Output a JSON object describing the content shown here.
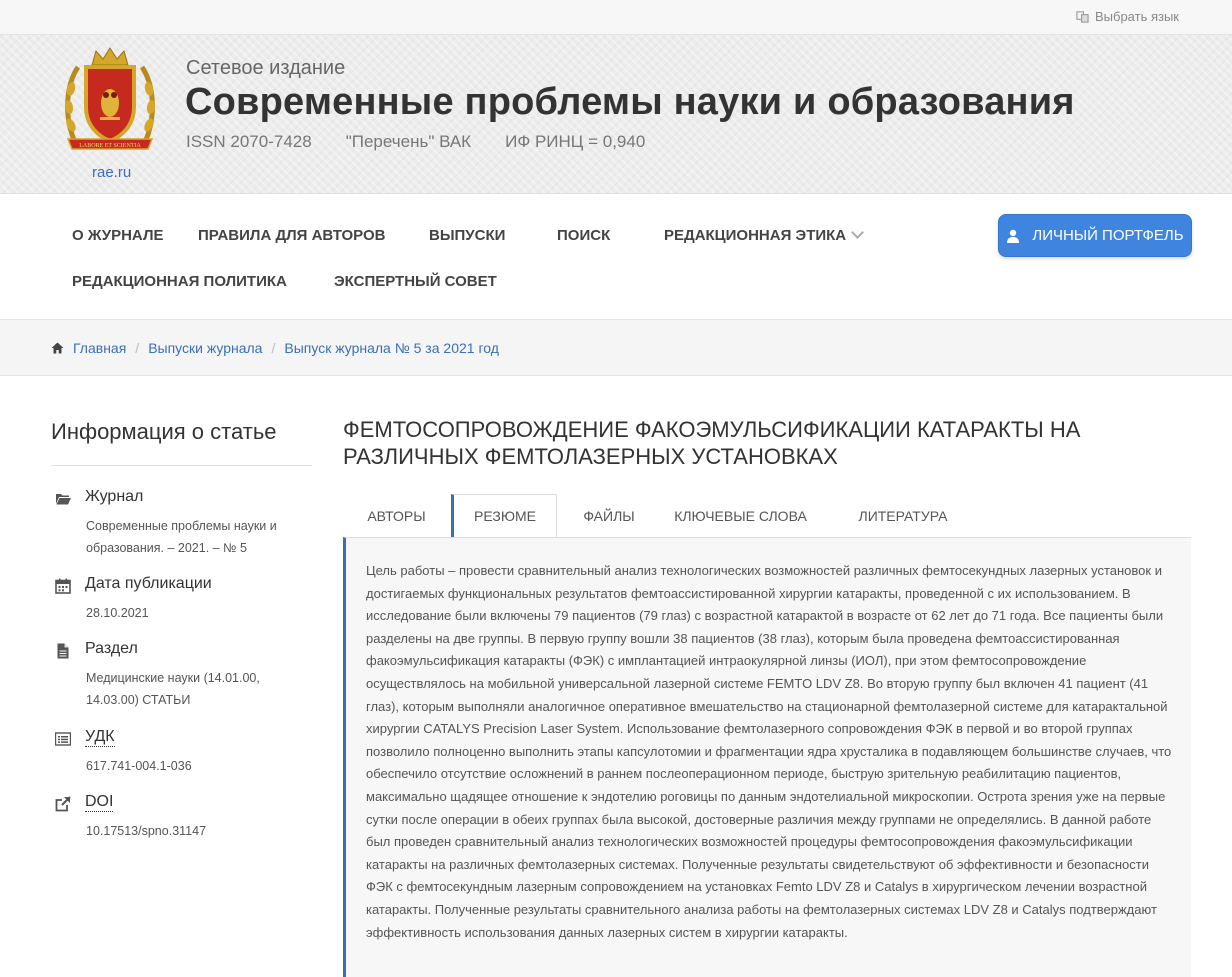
{
  "topbar": {
    "lang_label": "Выбрать язык"
  },
  "header": {
    "kicker": "Сетевое издание",
    "title": "Современные проблемы науки и образования",
    "issn": "ISSN 2070-7428",
    "vak": "\"Перечень\" ВАК",
    "rinc": "ИФ РИНЦ = 0,940",
    "site_link": "rae.ru",
    "logo_motto": "LABORE ET SCIENTIA"
  },
  "nav": {
    "items": [
      "О ЖУРНАЛЕ",
      "ПРАВИЛА ДЛЯ АВТОРОВ",
      "ВЫПУСКИ",
      "ПОИСК",
      "РЕДАКЦИОННАЯ ЭТИКА",
      "РЕДАКЦИОННАЯ ПОЛИТИКА",
      "ЭКСПЕРТНЫЙ СОВЕТ"
    ],
    "portfolio_label": "ЛИЧНЫЙ ПОРТФЕЛЬ"
  },
  "breadcrumb": [
    "Главная",
    "Выпуски журнала",
    "Выпуск журнала № 5 за 2021 год"
  ],
  "sidebar": {
    "title": "Информация о статье",
    "items": [
      {
        "icon": "folder-open-icon",
        "label": "Журнал",
        "value": "Современные проблемы науки и образования. – 2021. – № 5"
      },
      {
        "icon": "calendar-icon",
        "label": "Дата публикации",
        "value": "28.10.2021"
      },
      {
        "icon": "file-icon",
        "label": "Раздел",
        "value": "Медицинские науки (14.01.00, 14.03.00) СТАТЬИ"
      },
      {
        "icon": "list-icon",
        "label": "УДК",
        "value": "617.741-004.1-036"
      },
      {
        "icon": "external-link-icon",
        "label": "DOI",
        "value": "10.17513/spno.31147"
      }
    ]
  },
  "article": {
    "title": "ФЕМТОСОПРОВОЖДЕНИЕ ФАКОЭМУЛЬСИФИКАЦИИ КАТАРАКТЫ НА РАЗЛИЧНЫХ ФЕМТОЛАЗЕРНЫХ УСТАНОВКАХ",
    "tabs": [
      "АВТОРЫ",
      "РЕЗЮМЕ",
      "ФАЙЛЫ",
      "КЛЮЧЕВЫЕ СЛОВА",
      "ЛИТЕРАТУРА"
    ],
    "active_tab": "РЕЗЮМЕ",
    "abstract": "Цель работы – провести сравнительный анализ технологических возможностей различных фемтосекундных лазерных установок и достигаемых функциональных результатов фемтоассистированной хирургии катаракты, проведенной с их использованием. В исследование были включены 79 пациентов (79 глаз) с возрастной катарактой в возрасте от 62 лет до 71 года. Все пациенты были разделены на две группы. В первую группу вошли 38 пациентов (38 глаз), которым была проведена фемтоассистированная факоэмульсификация катаракты (ФЭК) с имплантацией интраокулярной линзы (ИОЛ), при этом фемтосопровождение осуществлялось на мобильной универсальной лазерной системе FEMTO LDV Z8. Во вторую группу был включен 41 пациент (41 глаз), которым выполняли аналогичное оперативное вмешательство на стационарной фемтолазерной системе для катарактальной хирургии CATALYS Precision Laser System. Использование фемтолазерного сопровождения ФЭК в первой и во второй группах позволило полноценно выполнить этапы капсулотомии и фрагментации ядра хрусталика в подавляющем большинстве случаев, что обеспечило отсутствие осложнений в раннем послеоперационном периоде, быструю зрительную реабилитацию пациентов, максимально щадящее отношение к эндотелию роговицы по данным эндотелиальной микроскопии. Острота зрения уже на первые сутки после операции в обеих группах была высокой, достоверные различия между группами не определялись. В данной работе был проведен сравнительный анализ технологических возможностей процедуры фемтосопровождения факоэмульсификации катаракты на различных фемтолазерных системах. Полученные результаты свидетельствуют об эффективности и безопасности ФЭК с фемтосекундным лазерным сопровождением на установках Femto LDV Z8 и Catalys в хирургическом лечении возрастной катаракты. Полученные результаты сравнительного анализа работы на фемтолазерных системах LDV Z8 и Catalys подтверждают эффективность использования данных лазерных систем в хирургии катаракты."
  }
}
